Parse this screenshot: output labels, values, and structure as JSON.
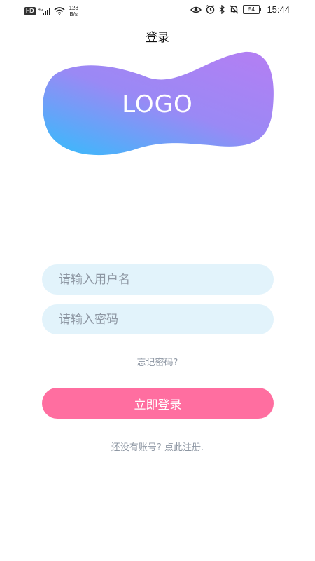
{
  "status_bar": {
    "hd": "HD",
    "network": "4G",
    "net_speed_value": "128",
    "net_speed_unit": "B/s",
    "battery": "54",
    "time": "15:44"
  },
  "header": {
    "title": "登录"
  },
  "logo": {
    "text": "LOGO",
    "gradient_start": "#3db8fb",
    "gradient_end": "#b27ff3"
  },
  "form": {
    "username_placeholder": "请输入用户名",
    "password_placeholder": "请输入密码",
    "forgot_password": "忘记密码?",
    "login_button": "立即登录",
    "register_link": "还没有账号? 点此注册."
  },
  "colors": {
    "input_background": "#e2f3fb",
    "button_background": "#ff6ea0",
    "muted_text": "#8e97a3"
  }
}
